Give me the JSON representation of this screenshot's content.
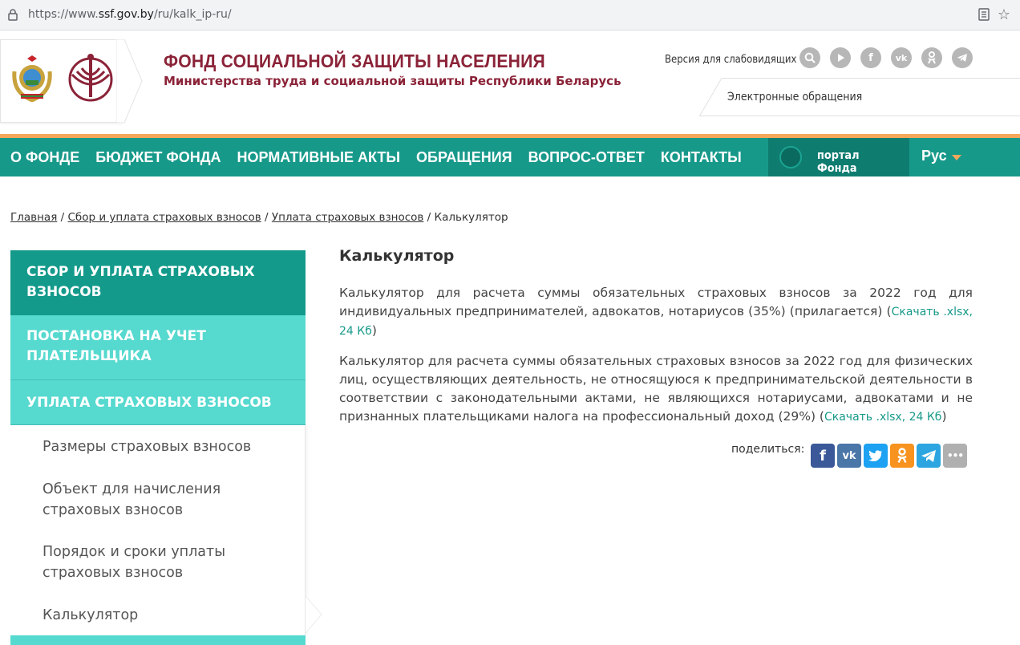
{
  "browser": {
    "url_prefix": "https://www.",
    "url_host": "ssf.gov.by",
    "url_path": "/ru/kalk_ip-ru/"
  },
  "header": {
    "org_title": "ФОНД СОЦИАЛЬНОЙ ЗАЩИТЫ НАСЕЛЕНИЯ",
    "org_subtitle": "Министерства труда и социальной защиты Республики Беларусь",
    "vision_link": "Версия для слабовидящих",
    "icons": [
      "search-icon",
      "youtube-icon",
      "facebook-icon",
      "vk-icon",
      "odnoklassniki-icon",
      "telegram-icon"
    ],
    "e_appeals": "Электронные обращения"
  },
  "nav": {
    "items": [
      "О ФОНДЕ",
      "БЮДЖЕТ ФОНДА",
      "НОРМАТИВНЫЕ АКТЫ",
      "ОБРАЩЕНИЯ",
      "ВОПРОС-ОТВЕТ",
      "КОНТАКТЫ"
    ],
    "portal": "портал Фонда",
    "language": "Рус"
  },
  "breadcrumb": {
    "items": [
      "Главная",
      "Сбор и уплата страховых взносов",
      "Уплата страховых взносов"
    ],
    "current": "Калькулятор",
    "separator": "/"
  },
  "sidebar": {
    "section": "СБОР И УПЛАТА СТРАХОВЫХ ВЗНОСОВ",
    "group1": "ПОСТАНОВКА НА УЧЕТ ПЛАТЕЛЬЩИКА",
    "group2": "УПЛАТА СТРАХОВЫХ ВЗНОСОВ",
    "links": [
      "Размеры страховых взносов",
      "Объект для начисления страховых взносов",
      "Порядок и сроки уплаты страховых взносов",
      "Калькулятор"
    ]
  },
  "content": {
    "title": "Калькулятор",
    "p1": "Калькулятор для расчета суммы обязательных страховых взносов за 2022 год для индивидуальных предпринимателей, адвокатов, нотариусов (35%) (прилагается)",
    "p1_link": "Скачать .xlsx, 24 Кб",
    "p2": "Калькулятор для расчета суммы обязательных страховых взносов за 2022 год для физических лиц, осуществляющих деятельность, не относящуюся к предпринимательской деятельности в соответствии с законодательными актами, не являющихся нотариусами, адвокатами и не признанных плательщиками налога на профессиональный доход (29%)",
    "p2_link": "Скачать .xlsx, 24 Кб",
    "share_label": "поделиться:",
    "share_buttons": [
      {
        "name": "facebook",
        "glyph": "f",
        "color": "#3b5998"
      },
      {
        "name": "vk",
        "glyph": "vk",
        "color": "#4a76a8"
      },
      {
        "name": "twitter",
        "glyph": "t",
        "color": "#1da1f2"
      },
      {
        "name": "odnoklassniki",
        "glyph": "ok",
        "color": "#f7931e"
      },
      {
        "name": "telegram",
        "glyph": "➤",
        "color": "#2ca5e0"
      },
      {
        "name": "more",
        "glyph": "•••",
        "color": "#b0b0b0"
      }
    ]
  }
}
